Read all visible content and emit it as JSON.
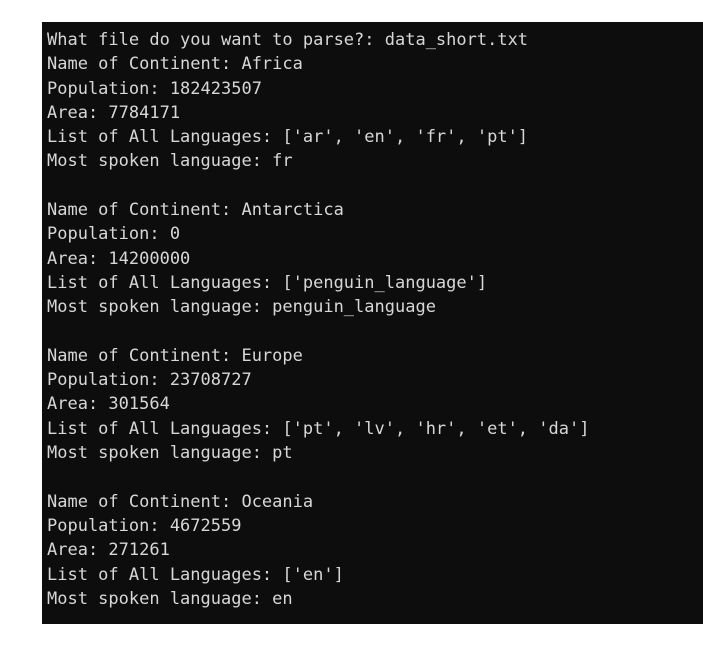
{
  "window": {
    "type": "terminal-console-output",
    "background_color": "#0d0d0d",
    "text_color": "#d7d7d7",
    "page_background_color": "#ffffff"
  },
  "prompt": {
    "question": "What file do you want to parse?:",
    "answer": "data_short.txt",
    "full_line": "What file do you want to parse?: data_short.txt"
  },
  "labels": {
    "continent": "Name of Continent:",
    "population": "Population:",
    "area": "Area:",
    "all_languages": "List of All Languages:",
    "most_spoken": "Most spoken language:"
  },
  "continents": [
    {
      "name": "Africa",
      "population": "182423507",
      "area": "7784171",
      "languages": "['ar', 'en', 'fr', 'pt']",
      "most_spoken": "fr"
    },
    {
      "name": "Antarctica",
      "population": "0",
      "area": "14200000",
      "languages": "['penguin_language']",
      "most_spoken": "penguin_language"
    },
    {
      "name": "Europe",
      "population": "23708727",
      "area": "301564",
      "languages": "['pt', 'lv', 'hr', 'et', 'da']",
      "most_spoken": "pt"
    },
    {
      "name": "Oceania",
      "population": "4672559",
      "area": "271261",
      "languages": "['en']",
      "most_spoken": "en"
    }
  ],
  "lines": [
    "What file do you want to parse?: data_short.txt",
    "Name of Continent: Africa",
    "Population: 182423507",
    "Area: 7784171",
    "List of All Languages: ['ar', 'en', 'fr', 'pt']",
    "Most spoken language: fr",
    "",
    "Name of Continent: Antarctica",
    "Population: 0",
    "Area: 14200000",
    "List of All Languages: ['penguin_language']",
    "Most spoken language: penguin_language",
    "",
    "Name of Continent: Europe",
    "Population: 23708727",
    "Area: 301564",
    "List of All Languages: ['pt', 'lv', 'hr', 'et', 'da']",
    "Most spoken language: pt",
    "",
    "Name of Continent: Oceania",
    "Population: 4672559",
    "Area: 271261",
    "List of All Languages: ['en']",
    "Most spoken language: en"
  ]
}
